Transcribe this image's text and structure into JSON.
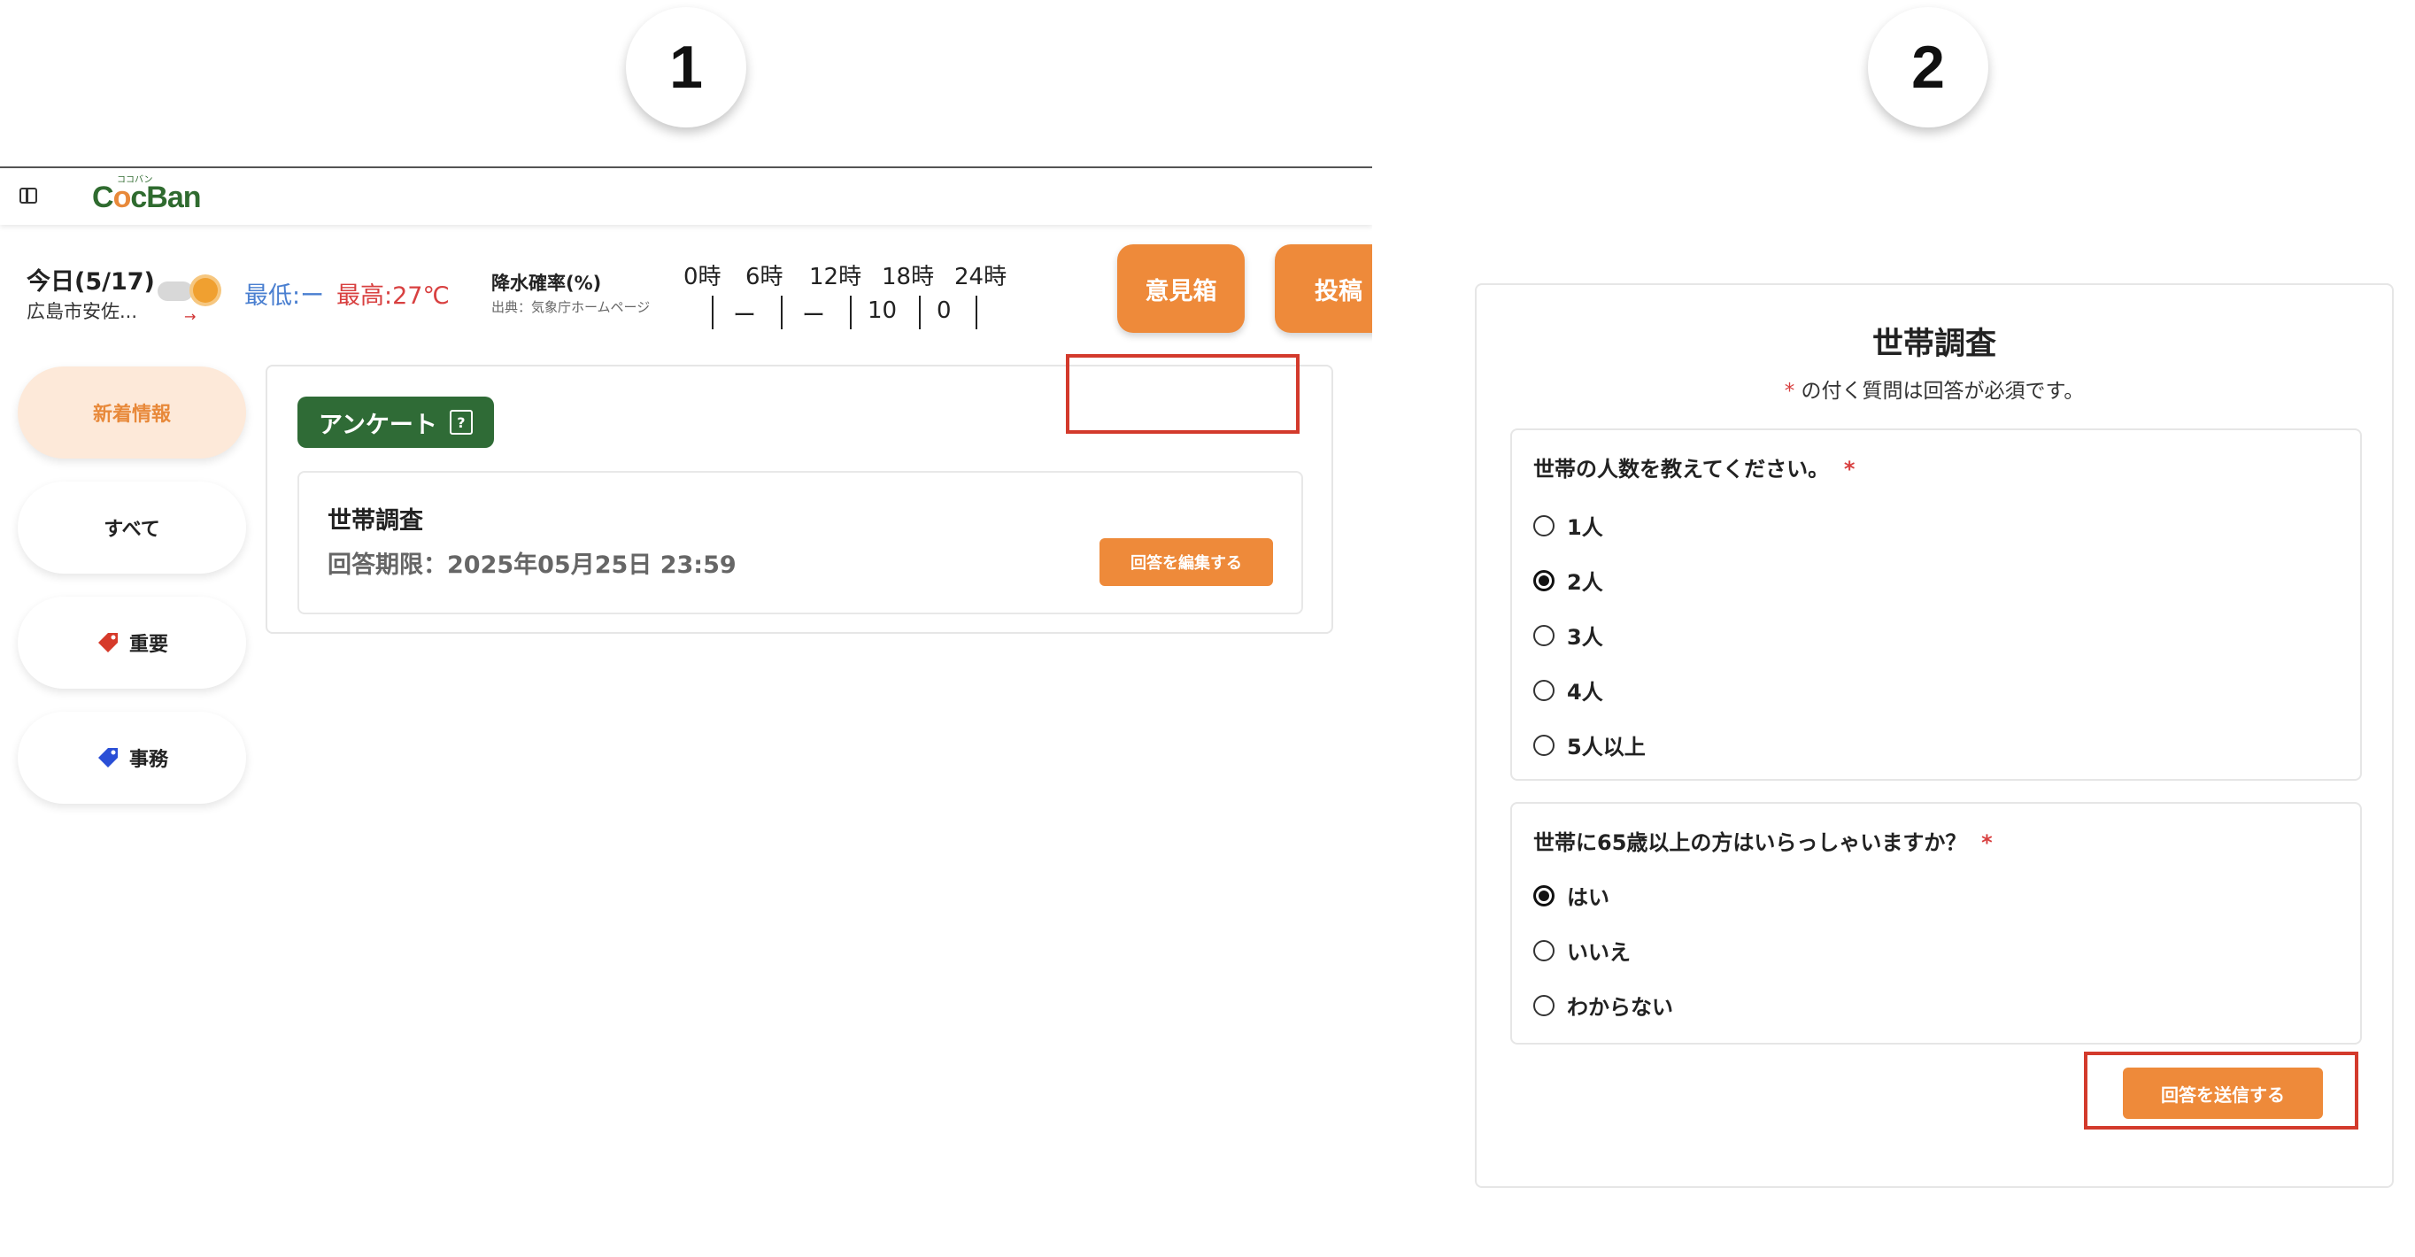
{
  "steps": {
    "one": "1",
    "two": "2"
  },
  "header": {
    "logo_prefix": "C",
    "logo_o": "o",
    "logo_c": "c",
    "logo_rest": "Ban",
    "logo_ruby": "ココバン"
  },
  "weather": {
    "date": "今日(5/17)",
    "place": "広島市安佐...",
    "min": "最低:ー",
    "max": "最高:27℃",
    "rain_title": "降水確率(%)",
    "rain_source": "出典：気象庁ホームページ",
    "hours": [
      "0時",
      "6時",
      "12時",
      "18時",
      "24時"
    ],
    "values": [
      "ー",
      "ー",
      "10",
      "0"
    ],
    "colors": {
      "min": "#4a7fd0",
      "max": "#d84040"
    }
  },
  "buttons": {
    "ikenbako": "意見箱",
    "toukou": "投稿"
  },
  "sidebar": {
    "items": [
      {
        "label": "新着情報"
      },
      {
        "label": "すべて"
      },
      {
        "label": "重要",
        "icon": "red-tag-icon"
      },
      {
        "label": "事務",
        "icon": "blue-tag-icon"
      }
    ]
  },
  "survey_list": {
    "badge": "アンケート",
    "badge_icon": "?",
    "item_title": "世帯調査",
    "deadline": "回答期限：2025年05月25日 23:59",
    "edit_button": "回答を編集する"
  },
  "form": {
    "title": "世帯調査",
    "note_star": "*",
    "note": " の付く質問は回答が必須です。",
    "q1": {
      "label": "世帯の人数を教えてください。",
      "star": "*",
      "options": [
        "1人",
        "2人",
        "3人",
        "4人",
        "5人以上"
      ],
      "selected": "2人"
    },
    "q2": {
      "label": "世帯に65歳以上の方はいらっしゃいますか？",
      "star": "*",
      "options": [
        "はい",
        "いいえ",
        "わからない"
      ],
      "selected": "はい"
    },
    "submit_button": "回答を送信する"
  },
  "colors": {
    "accent": "#ee8a3a",
    "brand_green": "#2f6b36",
    "highlight": "#d33a2c"
  }
}
